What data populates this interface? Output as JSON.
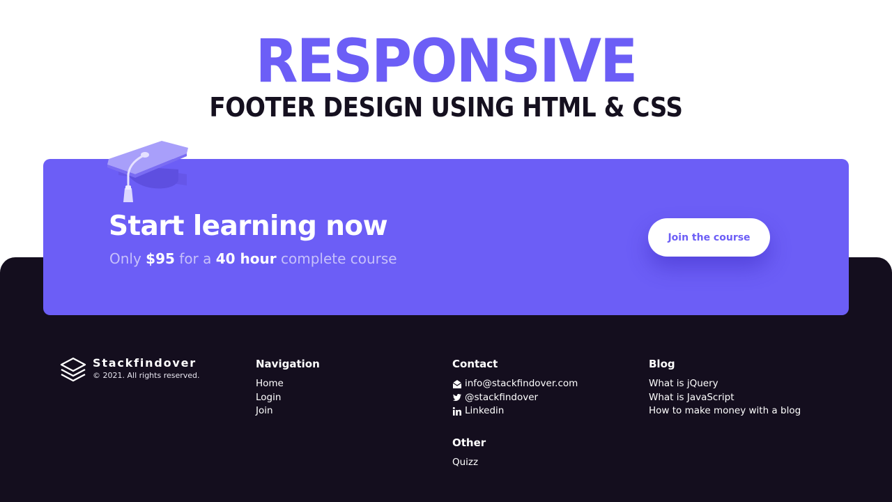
{
  "header": {
    "title": "RESPONSIVE",
    "subtitle": "FOOTER DESIGN USING HTML & CSS"
  },
  "cta": {
    "title": "Start learning now",
    "sub_prefix": "Only ",
    "price": "$95",
    "sub_mid": " for a ",
    "hours": "40 hour",
    "sub_suffix": " complete course",
    "button_label": "Join the course",
    "icon": "graduation-cap-icon"
  },
  "brand": {
    "name": "Stackfindover",
    "copyright": "© 2021. All rights reserved.",
    "logo_icon": "layers-icon"
  },
  "navigation": {
    "heading": "Navigation",
    "items": [
      "Home",
      "Login",
      "Join"
    ]
  },
  "contact": {
    "heading": "Contact",
    "items": [
      {
        "icon": "envelope-icon",
        "label": "info@stackfindover.com"
      },
      {
        "icon": "twitter-icon",
        "label": "@stackfindover"
      },
      {
        "icon": "linkedin-icon",
        "label": "Linkedin"
      }
    ]
  },
  "other": {
    "heading": "Other",
    "items": [
      "Quizz"
    ]
  },
  "blog": {
    "heading": "Blog",
    "items": [
      "What is jQuery",
      "What is JavaScript",
      "How to make money with a blog"
    ]
  },
  "colors": {
    "accent": "#6c5ef6",
    "footer_bg": "#140e1e",
    "text_dark": "#15101f",
    "cta_sub_text": "#c7c1fb"
  }
}
